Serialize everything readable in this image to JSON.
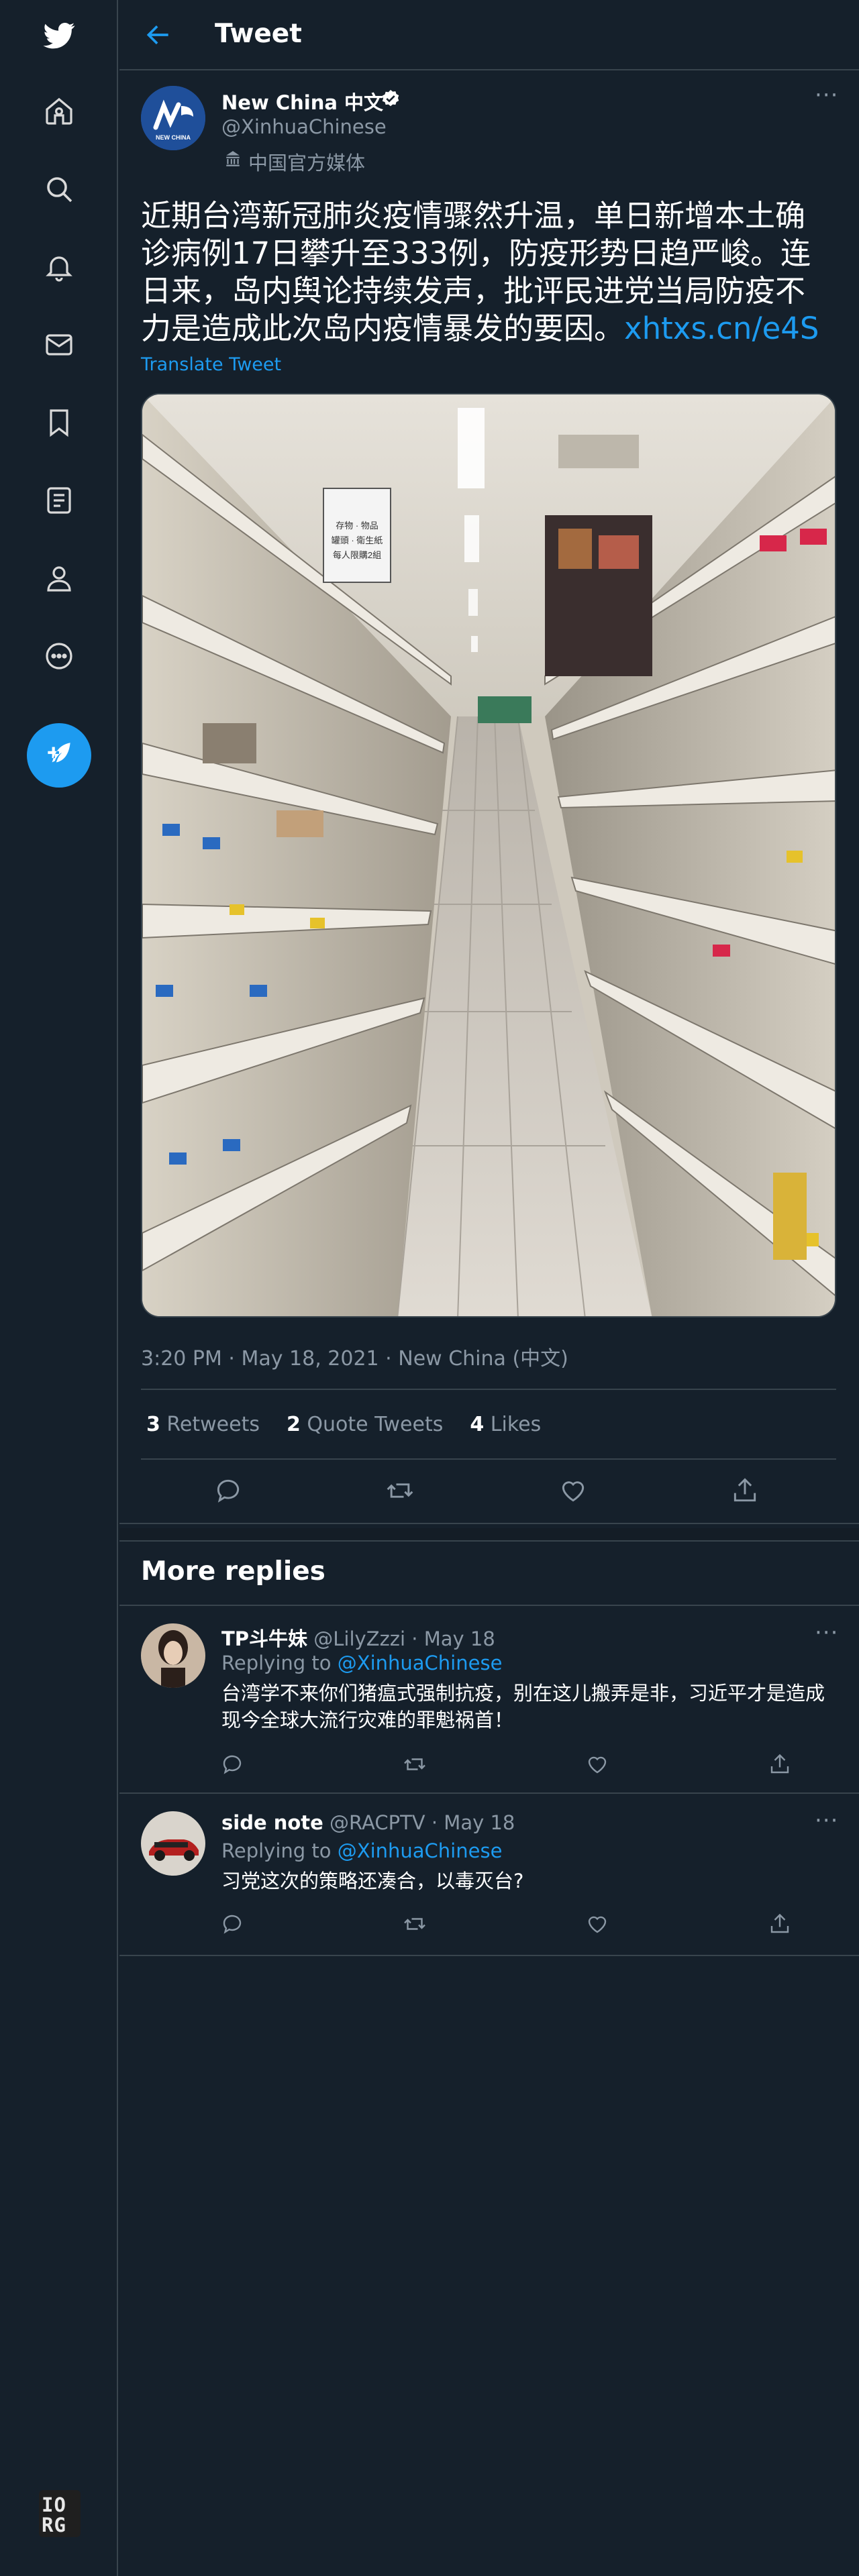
{
  "header": {
    "title": "Tweet"
  },
  "tweet": {
    "author_name": "New China 中文",
    "handle": "@XinhuaChinese",
    "label": "中国官方媒体",
    "text": "近期台湾新冠肺炎疫情骤然升温，单日新增本土确诊病例17日攀升至333例，防疫形势日趋严峻。连日来，岛内舆论持续发声，批评民进党当局防疫不力是造成此次岛内疫情暴发的要因。",
    "link": "xhtxs.cn/e4S",
    "translate": "Translate Tweet",
    "timestamp": "3:20 PM · May 18, 2021 · New China (中文)",
    "stats": {
      "retweets_count": "3",
      "retweets_label": "Retweets",
      "quotes_count": "2",
      "quotes_label": "Quote Tweets",
      "likes_count": "4",
      "likes_label": "Likes"
    },
    "photo_sign": "存物 · 物品\n罐頭 · 衛生紙\n每人限購2組",
    "avatar_text": "NEW CHINA"
  },
  "more_replies": {
    "title": "More replies"
  },
  "replies": [
    {
      "name": "TP斗牛妹",
      "handle": "@LilyZzzi",
      "date": "· May 18",
      "replying_prefix": "Replying to",
      "replying_to": "@XinhuaChinese",
      "text": "台湾学不来你们猪瘟式强制抗疫，别在这儿搬弄是非，习近平才是造成现今全球大流行灾难的罪魁祸首！"
    },
    {
      "name": "side note",
      "handle": "@RACPTV",
      "date": "· May 18",
      "replying_prefix": "Replying to",
      "replying_to": "@XinhuaChinese",
      "text": "习党这次的策略还凑合，以毒灭台?"
    }
  ],
  "footer": {
    "logo_text": "IO RG"
  },
  "colors": {
    "background": "#15202b",
    "accent": "#1d9bf0",
    "border": "#38444d",
    "secondary_text": "#8b98a5"
  },
  "icons": [
    "twitter-logo-icon",
    "home-icon",
    "explore-icon",
    "notifications-icon",
    "messages-icon",
    "bookmarks-icon",
    "lists-icon",
    "profile-icon",
    "more-icon",
    "compose-icon",
    "back-arrow-icon",
    "verified-icon",
    "reply-icon",
    "retweet-icon",
    "like-icon",
    "share-icon"
  ]
}
